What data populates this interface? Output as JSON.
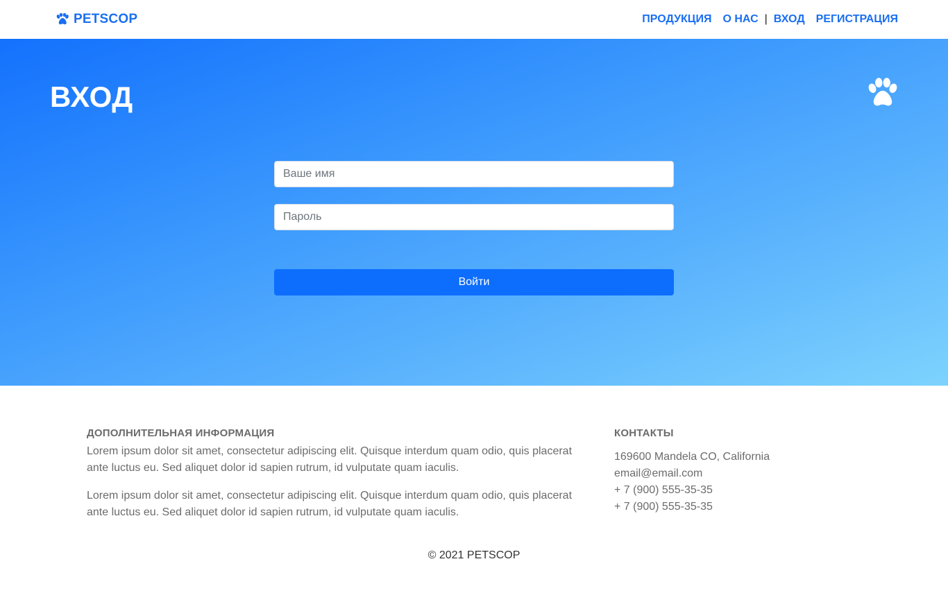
{
  "navbar": {
    "brand": "PETSCOP",
    "brand_icon": "paw-icon",
    "links": {
      "products": "ПРОДУКЦИЯ",
      "about": "О НАС",
      "separator": "|",
      "login": "ВХОД",
      "register": "РЕГИСТРАЦИЯ"
    }
  },
  "hero": {
    "title": "ВХОД",
    "icon": "paw-icon",
    "form": {
      "name_placeholder": "Ваше имя",
      "password_placeholder": "Пароль",
      "submit_label": "Войти"
    }
  },
  "footer": {
    "info": {
      "heading": "ДОПОЛНИТЕЛЬНАЯ ИНФОРМАЦИЯ",
      "paragraphs": [
        "Lorem ipsum dolor sit amet, consectetur adipiscing elit. Quisque interdum quam odio, quis placerat ante luctus eu. Sed aliquet dolor id sapien rutrum, id vulputate quam iaculis.",
        "Lorem ipsum dolor sit amet, consectetur adipiscing elit. Quisque interdum quam odio, quis placerat ante luctus eu. Sed aliquet dolor id sapien rutrum, id vulputate quam iaculis."
      ]
    },
    "contacts": {
      "heading": "КОНТАКТЫ",
      "address": "169600 Mandela CO, California",
      "email": "email@email.com",
      "phones": [
        "+ 7 (900) 555-35-35",
        "+ 7 (900) 555-35-35"
      ]
    },
    "copyright": "© 2021 PETSCOP"
  },
  "colors": {
    "brand": "#1a6ff0",
    "button": "#0d6efd",
    "hero_gradient_start": "#1371fd",
    "hero_gradient_end": "#7dd3fd"
  }
}
